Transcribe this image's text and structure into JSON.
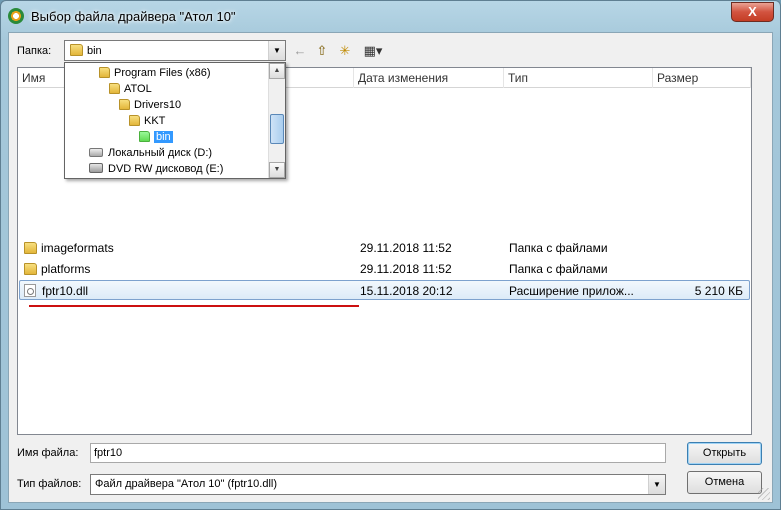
{
  "window": {
    "title": "Выбор файла драйвера \"Атол 10\"",
    "close_glyph": "X"
  },
  "folder": {
    "label": "Папка:",
    "current": "bin"
  },
  "toolbar": {
    "back_glyph": "←",
    "up_glyph": "⇧",
    "new_folder_glyph": "✳",
    "view_glyph": "▦▾"
  },
  "columns": {
    "name": "Имя",
    "date": "Дата изменения",
    "type": "Тип",
    "size": "Размер"
  },
  "files": [
    {
      "name": "imageformats",
      "date": "29.11.2018 11:52",
      "type": "Папка с файлами",
      "size": "",
      "kind": "folder"
    },
    {
      "name": "platforms",
      "date": "29.11.2018 11:52",
      "type": "Папка с файлами",
      "size": "",
      "kind": "folder"
    },
    {
      "name": "fptr10.dll",
      "date": "15.11.2018 20:12",
      "type": "Расширение прилож...",
      "size": "5 210 КБ",
      "kind": "dll",
      "selected": true
    }
  ],
  "dropdown": {
    "items": [
      {
        "label": "Program Files (x86)",
        "kind": "folder"
      },
      {
        "label": "ATOL",
        "kind": "folder"
      },
      {
        "label": "Drivers10",
        "kind": "folder"
      },
      {
        "label": "KKT",
        "kind": "folder"
      },
      {
        "label": "bin",
        "kind": "folder",
        "selected": true
      },
      {
        "label": "Локальный диск (D:)",
        "kind": "drive"
      },
      {
        "label": "DVD RW дисковод (E:)",
        "kind": "dvd"
      }
    ]
  },
  "filename": {
    "label": "Имя файла:",
    "value": "fptr10"
  },
  "filetype": {
    "label": "Тип файлов:",
    "value": "Файл драйвера \"Атол 10\" (fptr10.dll)"
  },
  "buttons": {
    "open": "Открыть",
    "cancel": "Отмена"
  },
  "colors": {
    "selection": "#3399ff",
    "underline": "#cc1010"
  }
}
